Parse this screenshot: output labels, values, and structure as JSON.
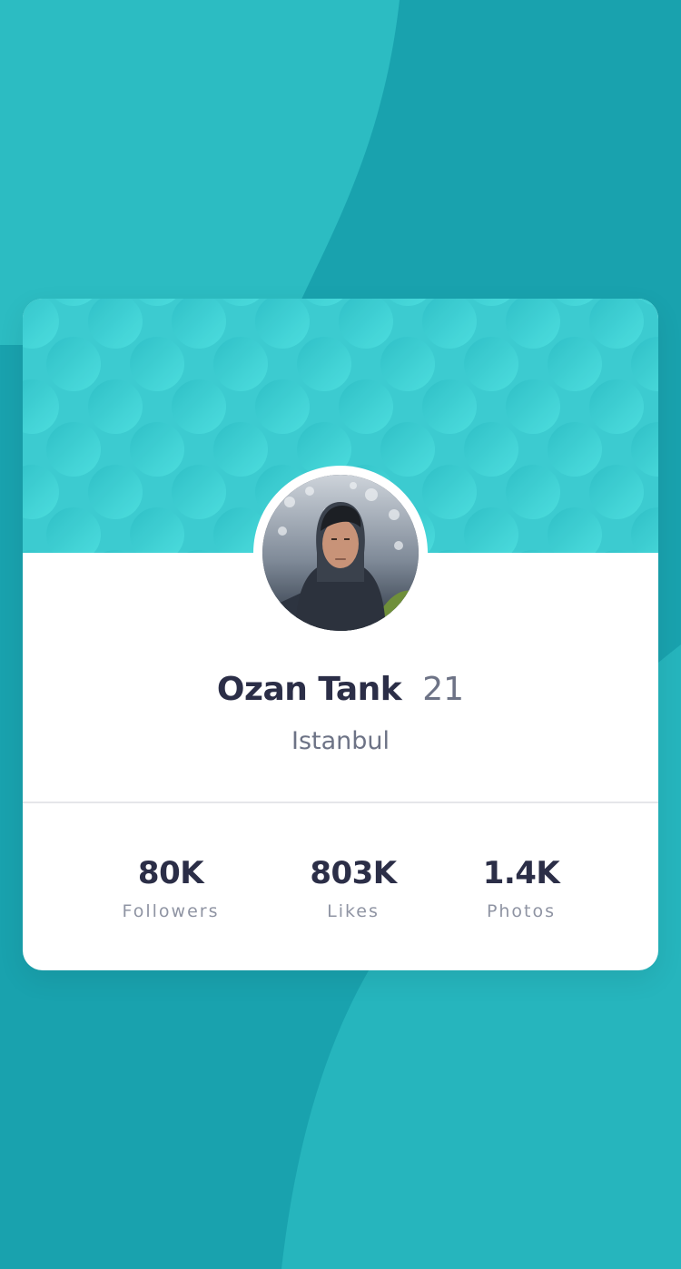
{
  "profile": {
    "name": "Ozan Tank",
    "age": "21",
    "city": "Istanbul"
  },
  "stats": [
    {
      "value": "80K",
      "label": "Followers"
    },
    {
      "value": "803K",
      "label": "Likes"
    },
    {
      "value": "1.4K",
      "label": "Photos"
    }
  ],
  "colors": {
    "background": "#19a2ae",
    "background_light": "#2cbcc2",
    "banner": "#3ccbd0",
    "card": "#ffffff",
    "name_text": "#2b2e47",
    "secondary_text": "#6d7386",
    "label_text": "#8f94a3"
  }
}
